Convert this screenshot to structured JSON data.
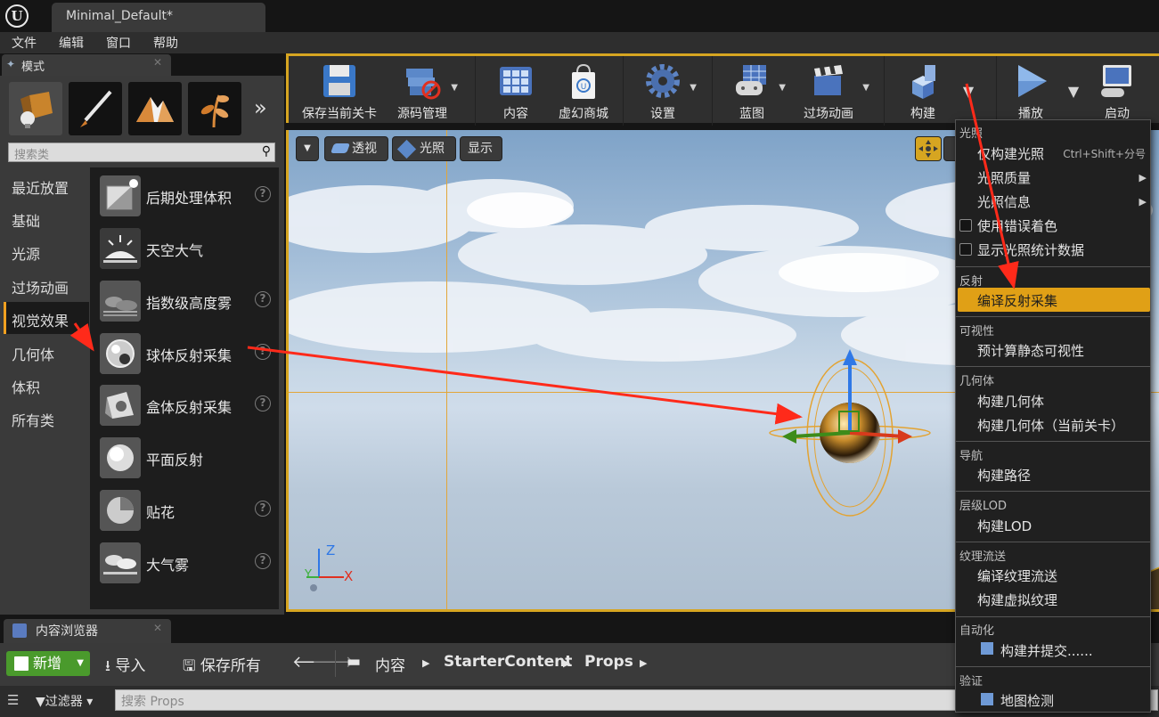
{
  "window": {
    "tab_title": "Minimal_Default*"
  },
  "menubar": {
    "items": [
      "文件",
      "编辑",
      "窗口",
      "帮助"
    ]
  },
  "modes": {
    "tab_label": "模式",
    "search_placeholder": "搜索类",
    "categories": [
      "最近放置",
      "基础",
      "光源",
      "过场动画",
      "视觉效果",
      "几何体",
      "体积",
      "所有类"
    ],
    "active_category": "视觉效果",
    "items": [
      "后期处理体积",
      "天空大气",
      "指数级高度雾",
      "球体反射采集",
      "盒体反射采集",
      "平面反射",
      "贴花",
      "大气雾"
    ],
    "help_glyph": "?"
  },
  "toolbar": {
    "save": "保存当前关卡",
    "source": "源码管理",
    "content": "内容",
    "market": "虚幻商城",
    "settings": "设置",
    "blueprint": "蓝图",
    "cinematics": "过场动画",
    "build": "构建",
    "play": "播放",
    "launch": "启动"
  },
  "viewport": {
    "perspective": "透视",
    "lighting": "光照",
    "show": "显示",
    "axis_x": "X",
    "axis_y": "Y",
    "axis_z": "Z"
  },
  "build_menu": {
    "sec_lighting": "光照",
    "build_lighting_only": "仅构建光照",
    "shortcut": "Ctrl+Shift+分号",
    "lighting_quality": "光照质量",
    "lighting_info": "光照信息",
    "use_error_coloring": "使用错误着色",
    "show_lighting_stats": "显示光照统计数据",
    "sec_reflection": "反射",
    "build_reflection_captures": "编译反射采集",
    "sec_visibility": "可视性",
    "precompute_visibility": "预计算静态可视性",
    "sec_geometry": "几何体",
    "build_geometry": "构建几何体",
    "build_geometry_current": "构建几何体（当前关卡）",
    "sec_navigation": "导航",
    "build_paths": "构建路径",
    "sec_hlod": "层级LOD",
    "build_lod": "构建LOD",
    "sec_texture": "纹理流送",
    "build_texture_streaming": "编译纹理流送",
    "build_virtual_texture": "构建虚拟纹理",
    "sec_automation": "自动化",
    "build_and_submit": "构建并提交......",
    "sec_verification": "验证",
    "map_check": "地图检测"
  },
  "content_browser": {
    "tab_label": "内容浏览器",
    "new": "新增",
    "import": "导入",
    "save_all": "保存所有",
    "path": [
      "内容",
      "StarterContent",
      "Props"
    ],
    "filters": "过滤器",
    "search_placeholder": "搜索 Props"
  },
  "colors": {
    "accent": "#d6a521",
    "highlight": "#e0a016",
    "new_button": "#4a9a2c",
    "annotation": "#ff2a1a"
  }
}
